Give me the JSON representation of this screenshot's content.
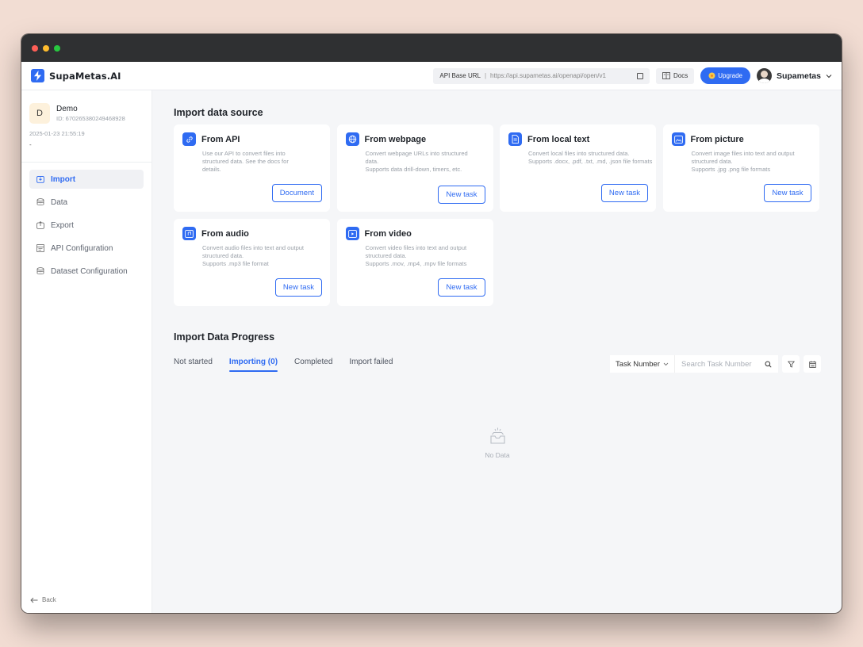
{
  "window": {
    "traffic_lights": {
      "close": "#ff5f57",
      "minimize": "#febc2e",
      "maximize": "#28c840"
    }
  },
  "header": {
    "brand": "SupaMetas.AI",
    "api_base_label": "API Base URL",
    "api_base_url": "https://api.supametas.ai/openapi/open/v1",
    "docs_label": "Docs",
    "upgrade_label": "Upgrade",
    "user_name": "Supametas"
  },
  "sidebar": {
    "profile": {
      "initial": "D",
      "name": "Demo",
      "id": "ID: 670265380249468928",
      "date": "2025-01-23 21:55:19",
      "extra": "-"
    },
    "items": [
      {
        "label": "Import",
        "icon": "import-icon"
      },
      {
        "label": "Data",
        "icon": "database-icon"
      },
      {
        "label": "Export",
        "icon": "export-icon"
      },
      {
        "label": "API Configuration",
        "icon": "api-config-icon"
      },
      {
        "label": "Dataset Configuration",
        "icon": "dataset-config-icon"
      }
    ],
    "back_label": "Back"
  },
  "import_section": {
    "title": "Import data source",
    "cards": [
      {
        "title": "From API",
        "icon": "link-icon",
        "desc": "Use our API to convert files into structured data. See the docs for details.",
        "button": "Document"
      },
      {
        "title": "From webpage",
        "icon": "globe-icon",
        "desc": "Convert webpage URLs into structured data.\nSupports data drill-down, timers, etc.",
        "button": "New task"
      },
      {
        "title": "From local text",
        "icon": "document-icon",
        "desc": "Convert local files into structured data.\nSupports .docx, .pdf, .txt, .md, .json file formats",
        "button": "New task"
      },
      {
        "title": "From picture",
        "icon": "image-icon",
        "desc": "Convert image files into text and output structured data.\nSupports .jpg .png file formats",
        "button": "New task"
      },
      {
        "title": "From audio",
        "icon": "audio-icon",
        "desc": "Convert audio files into text and output structured data.\nSupports .mp3 file format",
        "button": "New task"
      },
      {
        "title": "From video",
        "icon": "video-icon",
        "desc": "Convert video files into text and output structured data.\nSupports .mov, .mp4, .mpv file formats",
        "button": "New task"
      }
    ]
  },
  "progress_section": {
    "title": "Import Data Progress",
    "tabs": [
      "Not started",
      "Importing (0)",
      "Completed",
      "Import failed"
    ],
    "active_tab": "Importing (0)",
    "filter_select": "Task Number",
    "search_placeholder": "Search Task Number",
    "empty_text": "No Data"
  },
  "colors": {
    "accent": "#2f6bf2"
  }
}
